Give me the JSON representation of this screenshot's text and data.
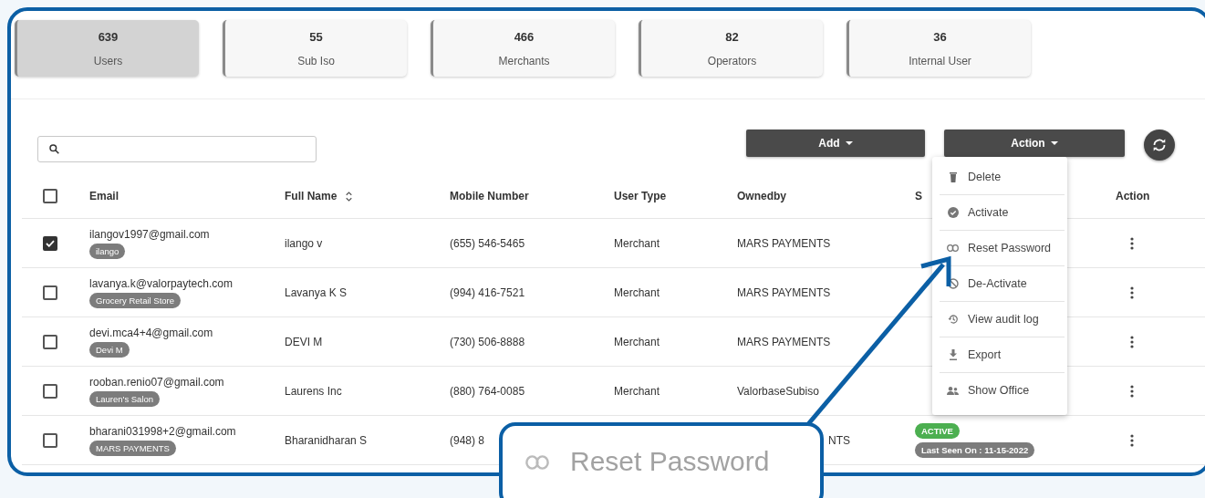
{
  "stats": [
    {
      "value": "639",
      "label": "Users",
      "selected": true
    },
    {
      "value": "55",
      "label": "Sub Iso",
      "selected": false
    },
    {
      "value": "466",
      "label": "Merchants",
      "selected": false
    },
    {
      "value": "82",
      "label": "Operators",
      "selected": false
    },
    {
      "value": "36",
      "label": "Internal User",
      "selected": false
    }
  ],
  "toolbar": {
    "add_button": "Add",
    "action_button": "Action"
  },
  "action_menu": {
    "expanded": true,
    "items": [
      {
        "label": "Delete"
      },
      {
        "label": "Activate"
      },
      {
        "label": "Reset Password"
      },
      {
        "label": "De-Activate"
      },
      {
        "label": "View audit log"
      },
      {
        "label": "Export"
      },
      {
        "label": "Show Office"
      }
    ]
  },
  "table": {
    "header_checked": false,
    "columns": [
      {
        "label": "Email",
        "sortable": false
      },
      {
        "label": "Full Name",
        "sortable": true
      },
      {
        "label": "Mobile Number",
        "sortable": false
      },
      {
        "label": "User Type",
        "sortable": false
      },
      {
        "label": "Ownedby",
        "sortable": false
      },
      {
        "label": "S",
        "sortable": false
      },
      {
        "label": "Action",
        "sortable": false
      }
    ],
    "rows": [
      {
        "checked": true,
        "email": "ilangov1997@gmail.com",
        "tag": "ilango",
        "full_name": "ilango v",
        "mobile": "(655) 546-5465",
        "user_type": "Merchant",
        "owned_by": "MARS PAYMENTS",
        "owned_by_cut": false
      },
      {
        "checked": false,
        "email": "lavanya.k@valorpaytech.com",
        "tag": "Grocery Retail Store",
        "full_name": "Lavanya K S",
        "mobile": "(994) 416-7521",
        "user_type": "Merchant",
        "owned_by": "MARS PAYMENTS",
        "owned_by_cut": false
      },
      {
        "checked": false,
        "email": "devi.mca4+4@gmail.com",
        "tag": "Devi M",
        "full_name": "DEVI M",
        "mobile": "(730) 506-8888",
        "user_type": "Merchant",
        "owned_by": "MARS PAYMENTS",
        "owned_by_cut": false
      },
      {
        "checked": false,
        "email": "rooban.renio07@gmail.com",
        "tag": "Lauren's Salon",
        "full_name": "Laurens Inc",
        "mobile": "(880) 764-0085",
        "user_type": "Merchant",
        "owned_by": "ValorbaseSubiso",
        "owned_by_cut": false
      },
      {
        "checked": false,
        "email": "bharani031998+2@gmail.com",
        "tag": "MARS PAYMENTS",
        "full_name": "Bharanidharan S",
        "mobile": "(948) 8",
        "owned_by": "NTS",
        "owned_by_cut": true,
        "status": {
          "state": "ACTIVE",
          "last_seen": "Last Seen On : 11-15-2022"
        }
      }
    ]
  },
  "callout": {
    "label": "Reset Password"
  }
}
